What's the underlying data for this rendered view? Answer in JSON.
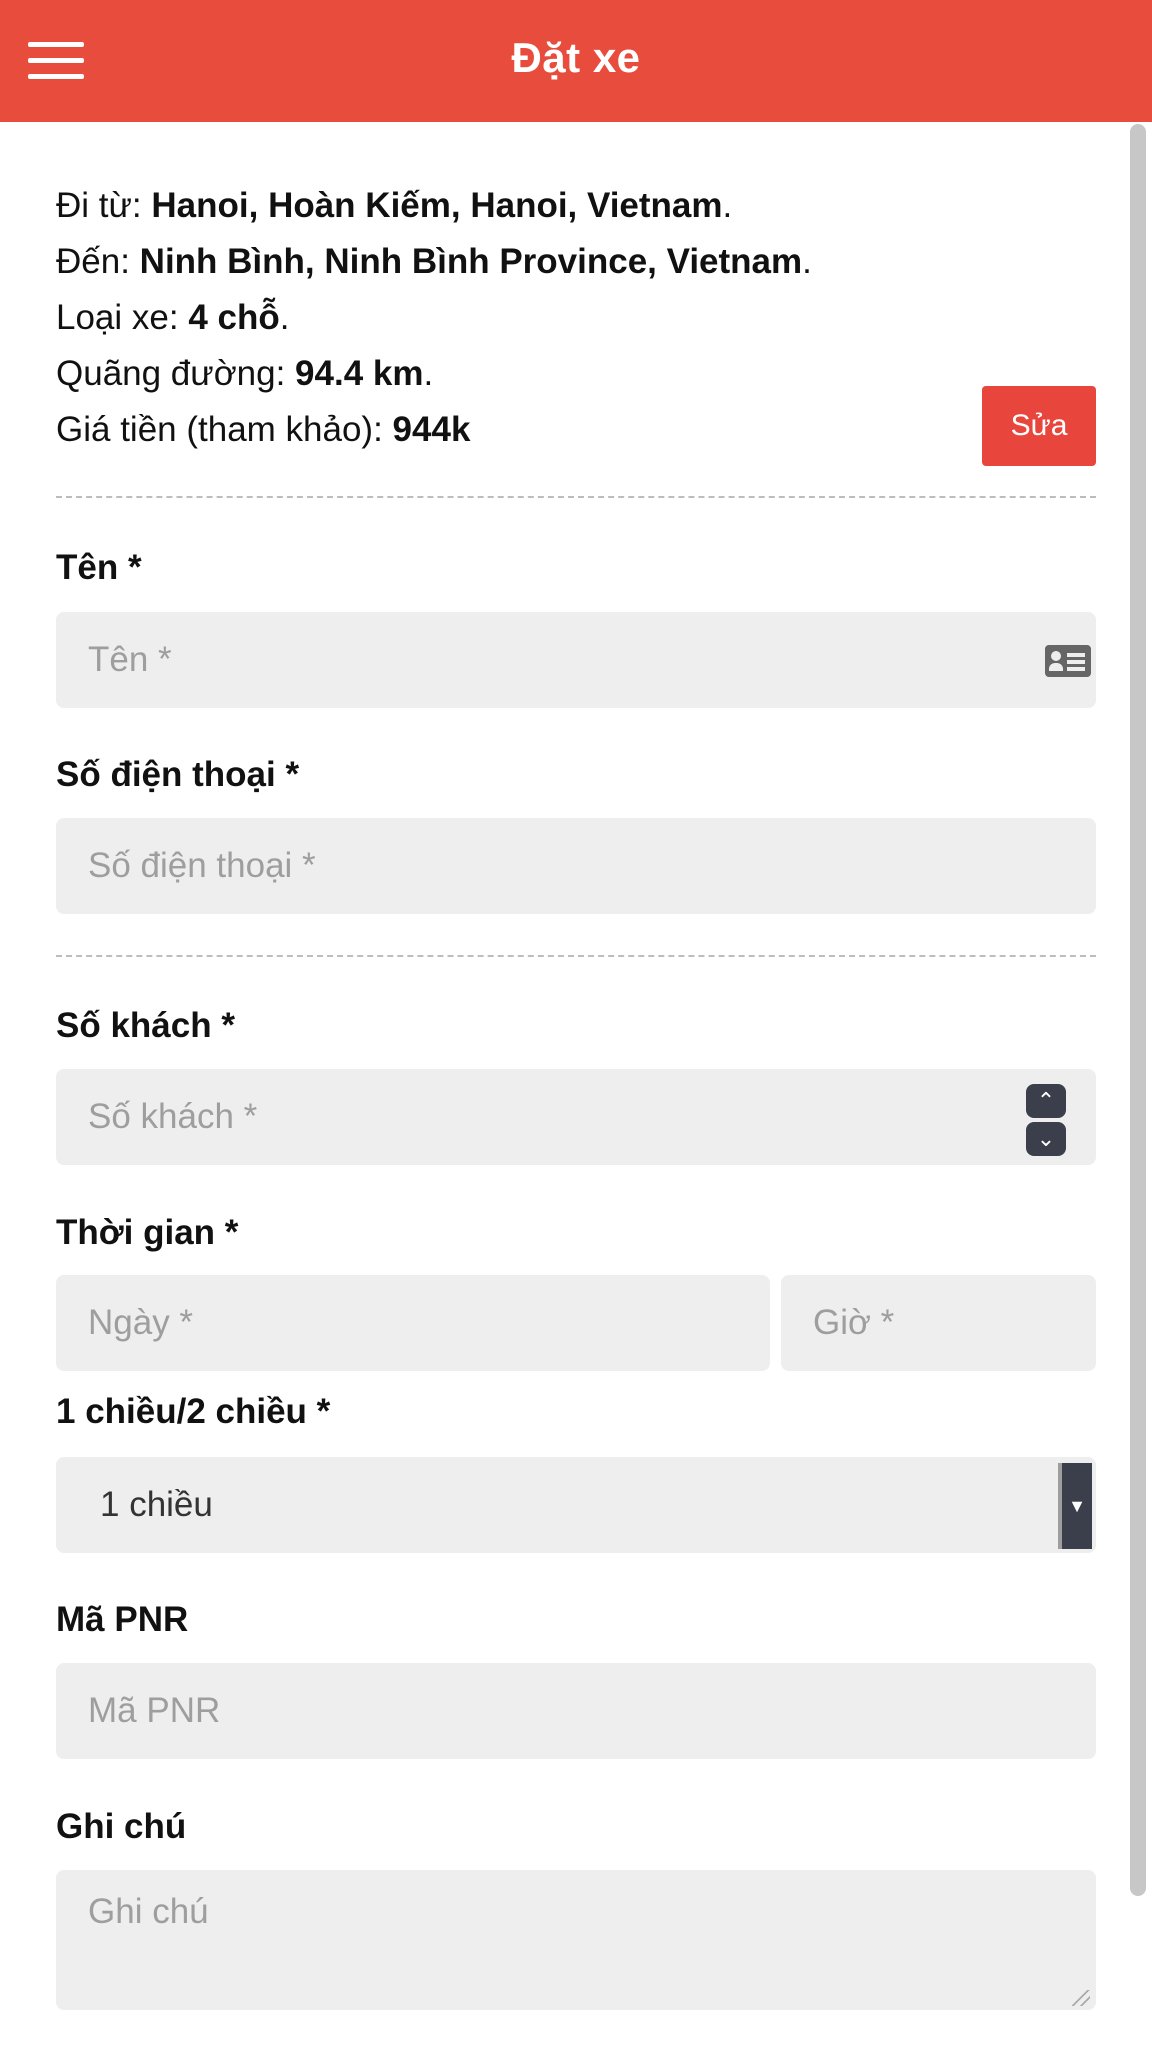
{
  "header": {
    "title": "Đặt xe"
  },
  "summary": {
    "from_label": "Đi từ:",
    "from_value": "Hanoi, Hoàn Kiếm, Hanoi, Vietnam",
    "to_label": "Đến:",
    "to_value": "Ninh Bình, Ninh Bình Province, Vietnam",
    "vehicle_label": "Loại xe:",
    "vehicle_value": "4 chỗ",
    "distance_label": "Quãng đường:",
    "distance_value": "94.4 km",
    "price_label": "Giá tiền (tham khảo):",
    "price_value": "944k",
    "period": ".",
    "edit_button": "Sửa"
  },
  "form": {
    "name": {
      "label": "Tên *",
      "placeholder": "Tên *"
    },
    "phone": {
      "label": "Số điện thoại *",
      "placeholder": "Số điện thoại *"
    },
    "passengers": {
      "label": "Số khách *",
      "placeholder": "Số khách *"
    },
    "time": {
      "label": "Thời gian *",
      "date_placeholder": "Ngày *",
      "hour_placeholder": "Giờ *"
    },
    "trip_type": {
      "label": "1 chiều/2 chiều *",
      "selected": "1 chiều"
    },
    "pnr": {
      "label": "Mã PNR",
      "placeholder": "Mã PNR"
    },
    "note": {
      "label": "Ghi chú",
      "placeholder": "Ghi chú"
    }
  },
  "icons": {
    "menu": "hamburger-menu-icon",
    "name_field": "id-card-icon",
    "stepper_up": "chevron-up-icon",
    "stepper_down": "chevron-down-icon",
    "select_arrow": "caret-down-icon"
  },
  "colors": {
    "header": "#e84c3d",
    "button": "#e8453c",
    "field_bg": "#eeeeee"
  }
}
